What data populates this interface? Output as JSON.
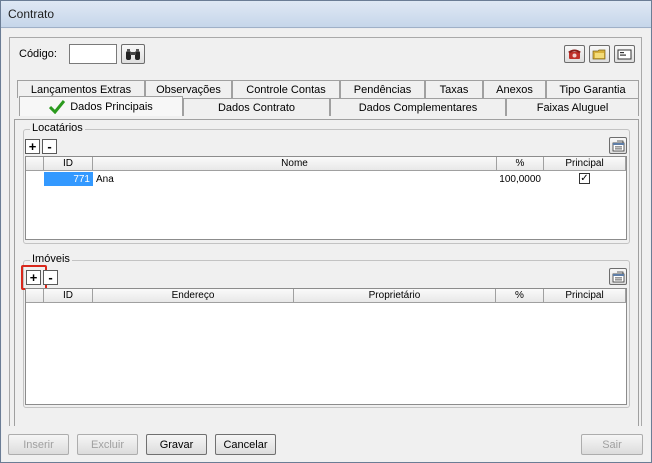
{
  "window": {
    "title": "Contrato"
  },
  "header": {
    "codigo_label": "Código:",
    "codigo_value": ""
  },
  "tabs_row1": [
    {
      "label": "Lançamentos Extras"
    },
    {
      "label": "Observações"
    },
    {
      "label": "Controle Contas"
    },
    {
      "label": "Pendências"
    },
    {
      "label": "Taxas"
    },
    {
      "label": "Anexos"
    },
    {
      "label": "Tipo Garantia"
    }
  ],
  "tabs_row2": [
    {
      "label": "Dados Principais",
      "active": true
    },
    {
      "label": "Dados Contrato"
    },
    {
      "label": "Dados Complementares"
    },
    {
      "label": "Faixas Aluguel"
    }
  ],
  "locatarios": {
    "title": "Locatários",
    "add_label": "+",
    "remove_label": "-",
    "columns": [
      "ID",
      "Nome",
      "%",
      "Principal"
    ],
    "rows": [
      {
        "id": "771",
        "nome": "Ana",
        "percent": "100,0000",
        "principal": "✓"
      }
    ]
  },
  "imoveis": {
    "title": "Imóveis",
    "add_label": "+",
    "remove_label": "-",
    "columns": [
      "ID",
      "Endereço",
      "Proprietário",
      "%",
      "Principal"
    ]
  },
  "footer": {
    "inserir": "Inserir",
    "excluir": "Excluir",
    "gravar": "Gravar",
    "cancelar": "Cancelar",
    "sair": "Sair"
  },
  "icons": {
    "search": "binoculars-icon",
    "phone": "phone-icon",
    "folder": "folder-icon",
    "card": "card-icon",
    "export": "export-icon"
  },
  "colors": {
    "selection": "#3399ff",
    "highlight_box": "#d9281c",
    "check_green": "#2b9a1e"
  }
}
